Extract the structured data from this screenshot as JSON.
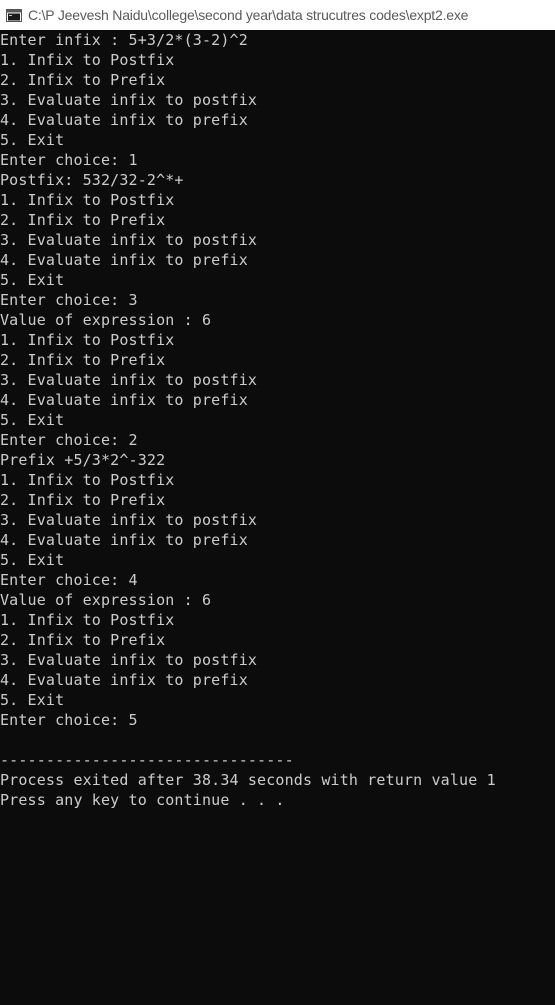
{
  "window": {
    "title": "C:\\P Jeevesh Naidu\\college\\second year\\data strucutres codes\\expt2.exe",
    "icon": "console-app-icon"
  },
  "console": {
    "lines": [
      "Enter infix : 5+3/2*(3-2)^2",
      "1. Infix to Postfix",
      "2. Infix to Prefix",
      "3. Evaluate infix to postfix",
      "4. Evaluate infix to prefix",
      "5. Exit",
      "Enter choice: 1",
      "Postfix: 532/32-2^*+",
      "1. Infix to Postfix",
      "2. Infix to Prefix",
      "3. Evaluate infix to postfix",
      "4. Evaluate infix to prefix",
      "5. Exit",
      "Enter choice: 3",
      "Value of expression : 6",
      "1. Infix to Postfix",
      "2. Infix to Prefix",
      "3. Evaluate infix to postfix",
      "4. Evaluate infix to prefix",
      "5. Exit",
      "Enter choice: 2",
      "Prefix +5/3*2^-322",
      "1. Infix to Postfix",
      "2. Infix to Prefix",
      "3. Evaluate infix to postfix",
      "4. Evaluate infix to prefix",
      "5. Exit",
      "Enter choice: 4",
      "Value of expression : 6",
      "1. Infix to Postfix",
      "2. Infix to Prefix",
      "3. Evaluate infix to postfix",
      "4. Evaluate infix to prefix",
      "5. Exit",
      "Enter choice: 5",
      "",
      "--------------------------------",
      "Process exited after 38.34 seconds with return value 1",
      "Press any key to continue . . ."
    ]
  },
  "colors": {
    "console_background": "#0c0c0c",
    "console_text": "#cccccc",
    "titlebar_background": "#ffffff",
    "titlebar_text": "#5a5a5a"
  }
}
